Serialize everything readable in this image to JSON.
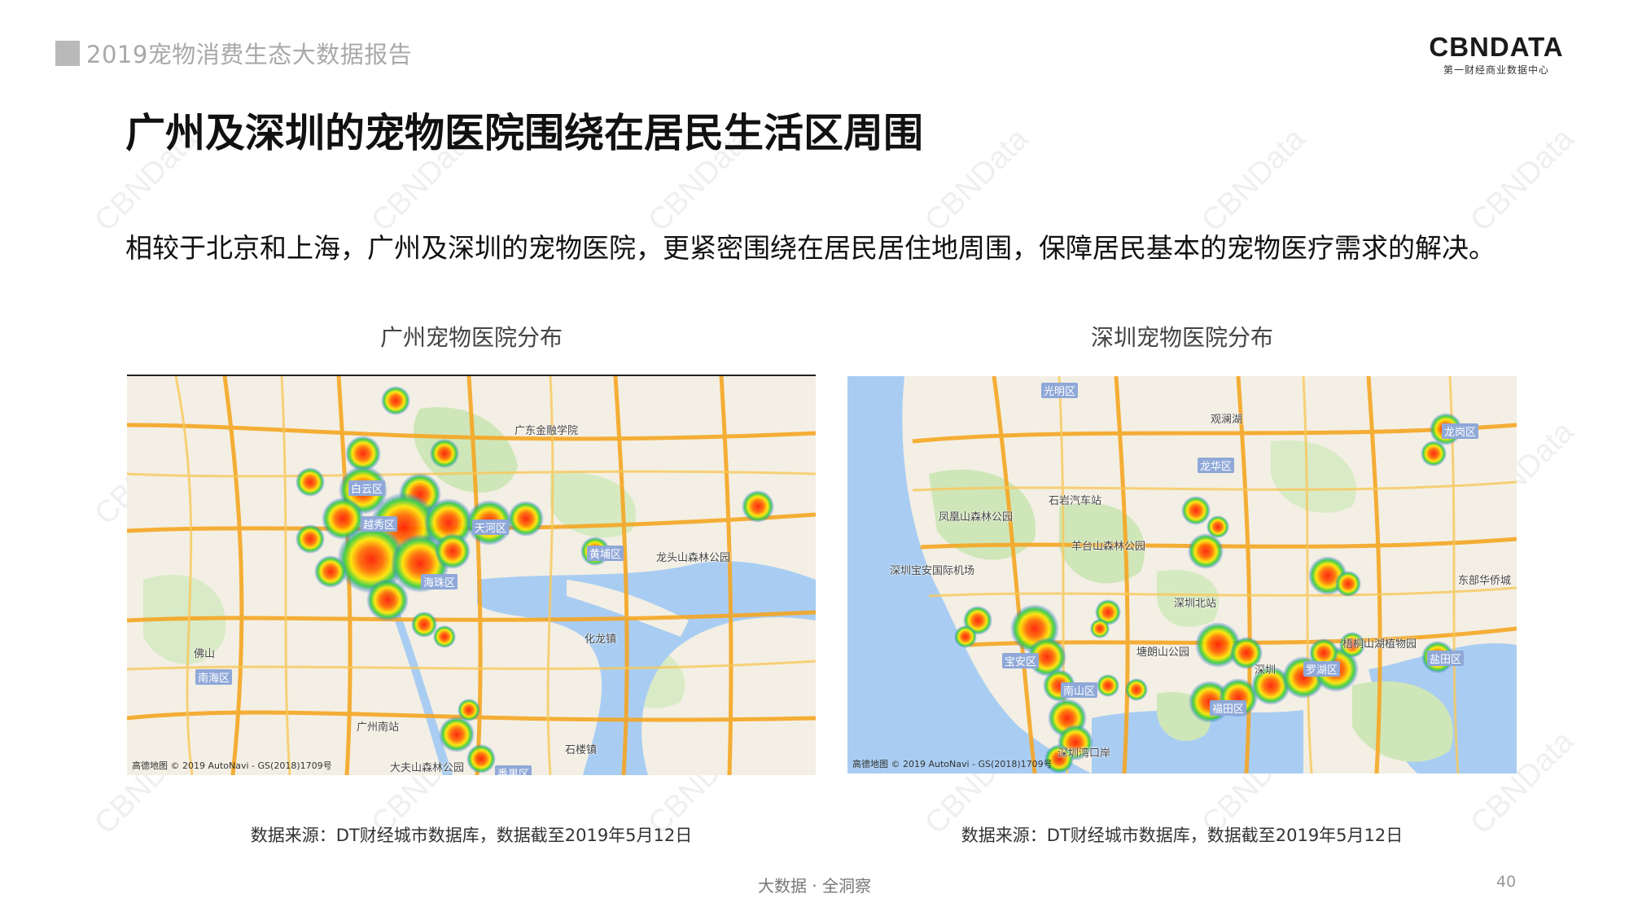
{
  "header": {
    "report_title": "2019宠物消费生态大数据报告",
    "logo_main": "CBNDATA",
    "logo_sub": "第一财经商业数据中心"
  },
  "slide": {
    "title": "广州及深圳的宠物医院围绕在居民生活区周围",
    "description": "相较于北京和上海，广州及深圳的宠物医院，更紧密围绕在居民居住地周围，保障居民基本的宠物医疗需求的解决。"
  },
  "maps": {
    "guangzhou": {
      "title": "广州宠物医院分布",
      "copyright": "高德地图 © 2019 AutoNavi - GS(2018)1709号",
      "places": [
        "白云区",
        "越秀区",
        "天河区",
        "海珠区",
        "黄埔区",
        "佛山",
        "广州南站",
        "番禺区",
        "龙头山森林公园",
        "广东金融学院",
        "南海区",
        "化龙镇",
        "石楼镇",
        "大夫山森林公园"
      ],
      "source": "数据来源：DT财经城市数据库，数据截至2019年5月12日"
    },
    "shenzhen": {
      "title": "深圳宠物医院分布",
      "copyright": "高德地图 © 2019 AutoNavi - GS(2018)1709号",
      "places": [
        "光明区",
        "观澜湖",
        "龙岗区",
        "龙华区",
        "石岩汽车站",
        "凤凰山森林公园",
        "羊台山森林公园",
        "深圳宝安国际机场",
        "深圳北站",
        "宝安区",
        "塘朗山公园",
        "南山区",
        "深圳",
        "罗湖区",
        "福田区",
        "盐田区",
        "深圳湾口岸",
        "梧桐山湖植物园",
        "东部华侨城"
      ],
      "source": "数据来源：DT财经城市数据库，数据截至2019年5月12日"
    }
  },
  "footer": {
    "tagline": "大数据 · 全洞察",
    "page_number": "40"
  },
  "watermark_text": "CBNData"
}
